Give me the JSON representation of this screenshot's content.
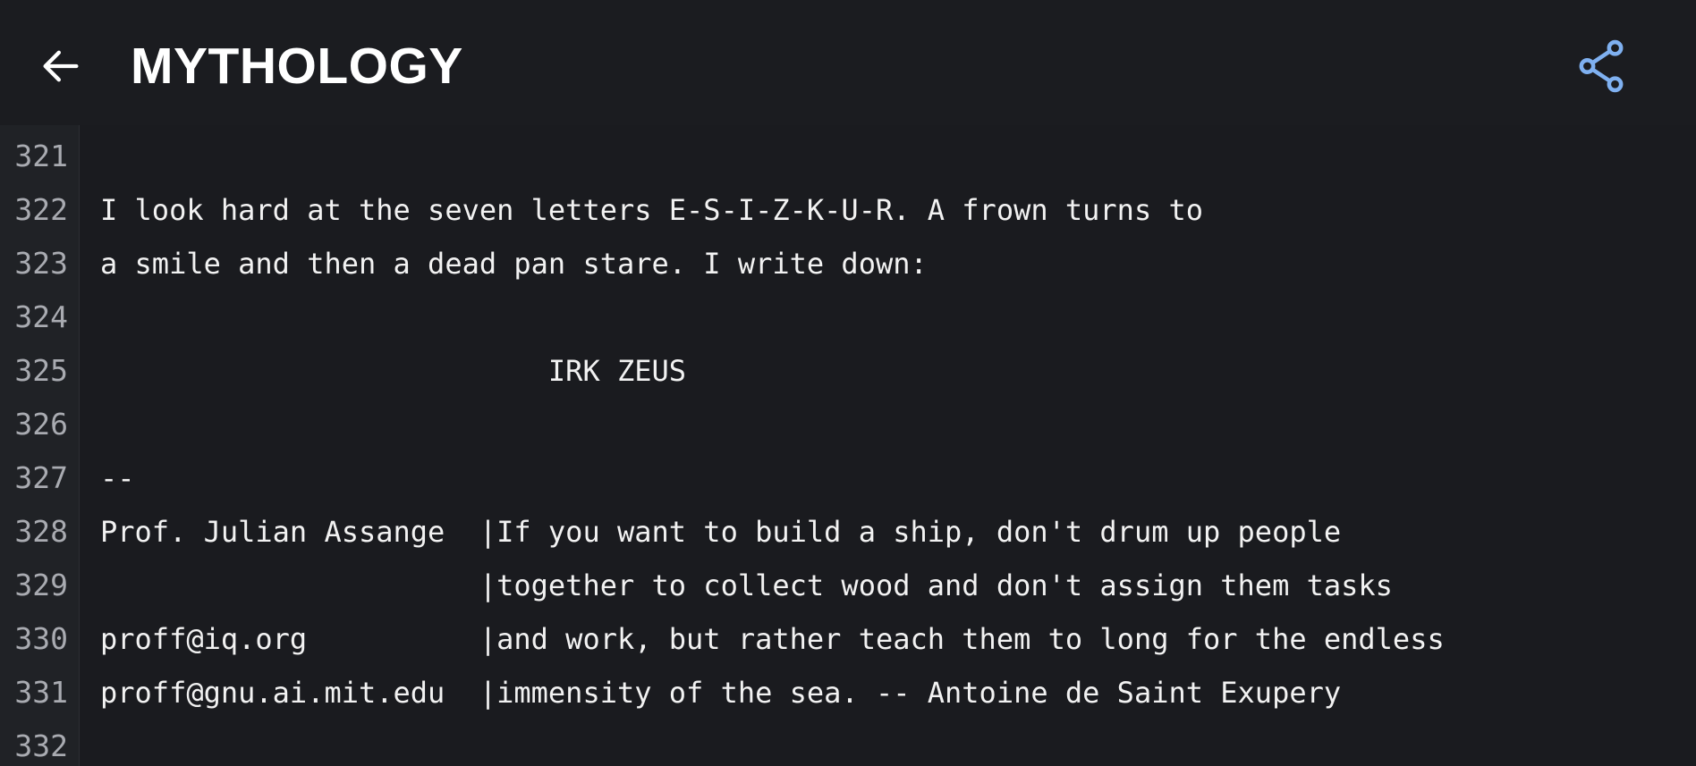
{
  "header": {
    "title": "MYTHOLOGY",
    "back_icon": "arrow-left-icon",
    "share_icon": "share-icon",
    "accent_color": "#7fb0f0"
  },
  "editor": {
    "lines": [
      {
        "number": "321",
        "text": ""
      },
      {
        "number": "322",
        "text": "I look hard at the seven letters E-S-I-Z-K-U-R. A frown turns to"
      },
      {
        "number": "323",
        "text": "a smile and then a dead pan stare. I write down:"
      },
      {
        "number": "324",
        "text": ""
      },
      {
        "number": "325",
        "text": "                          IRK ZEUS"
      },
      {
        "number": "326",
        "text": ""
      },
      {
        "number": "327",
        "text": "--"
      },
      {
        "number": "328",
        "text": "Prof. Julian Assange  |If you want to build a ship, don't drum up people"
      },
      {
        "number": "329",
        "text": "                      |together to collect wood and don't assign them tasks"
      },
      {
        "number": "330",
        "text": "proff@iq.org          |and work, but rather teach them to long for the endless"
      },
      {
        "number": "331",
        "text": "proff@gnu.ai.mit.edu  |immensity of the sea. -- Antoine de Saint Exupery"
      },
      {
        "number": "332",
        "text": ""
      }
    ]
  }
}
